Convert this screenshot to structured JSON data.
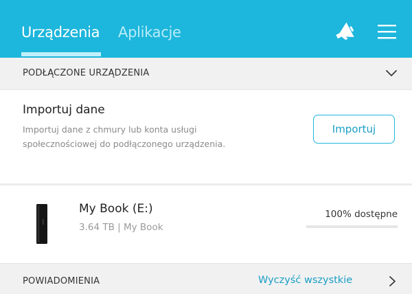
{
  "header": {
    "tabs": [
      {
        "label": "Urządzenia",
        "active": true
      },
      {
        "label": "Aplikacje",
        "active": false
      }
    ],
    "icons": [
      "megaphone-icon",
      "hamburger-menu-icon"
    ],
    "background_color": "#1db6dc"
  },
  "connected_devices": {
    "title": "PODŁĄCZONE URZĄDZENIA",
    "toggle_icon": "chevron-down-icon",
    "import": {
      "title": "Importuj dane",
      "description": "Importuj dane z chmury lub konta usługi społecznościowej do podłączonego urządzenia.",
      "button_label": "Importuj"
    },
    "devices": [
      {
        "name": "My Book (E:)",
        "meta": "3.64 TB | My Book",
        "status": "100% dostępne",
        "available_fraction": 1.0
      }
    ]
  },
  "notifications": {
    "title": "POWIADOMIENIA",
    "clear_label": "Wyczyść wszystkie",
    "expand_icon": "chevron-right-icon"
  },
  "colors": {
    "accent": "#1db6dc",
    "link": "#1a9fc4",
    "section_background": "#f1f1f2"
  }
}
